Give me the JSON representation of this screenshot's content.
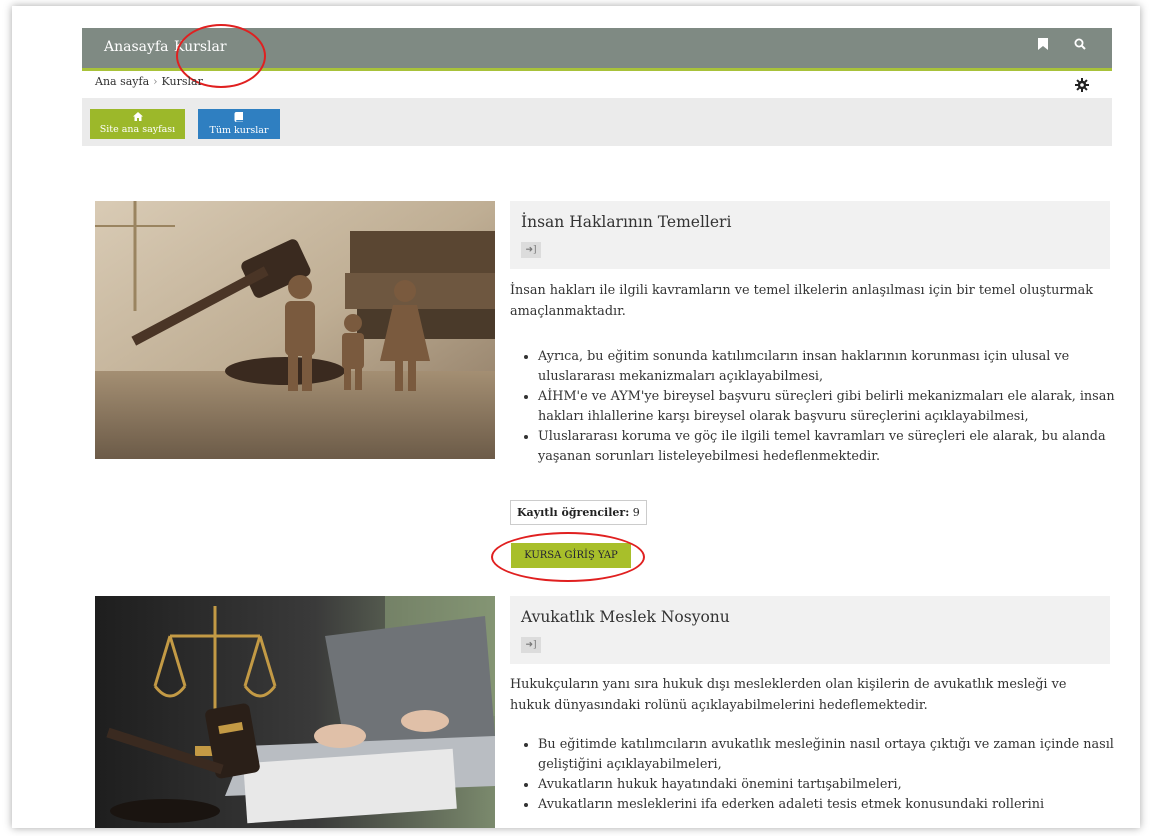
{
  "nav": {
    "home": "Anasayfa",
    "courses": "Kurslar"
  },
  "breadcrumb": {
    "home": "Ana sayfa",
    "separator": "›",
    "current": "Kurslar"
  },
  "toolbar": {
    "site_home": "Site ana sayfası",
    "all_courses": "Tüm kurslar"
  },
  "courses": [
    {
      "title": "İnsan Haklarının Temelleri",
      "summary": "İnsan hakları ile ilgili kavramların ve temel ilkelerin anlaşılması için bir temel oluşturmak amaçlanmaktadır.",
      "bullets": [
        "Ayrıca, bu eğitim sonunda katılımcıların insan haklarının korunması için ulusal ve uluslararası mekanizmaları açıklayabilmesi,",
        "AİHM'e ve AYM'ye bireysel başvuru süreçleri gibi belirli mekanizmaları ele alarak, insan hakları ihlallerine karşı bireysel olarak başvuru süreçlerini açıklayabilmesi,",
        "Uluslararası koruma ve göç ile ilgili temel kavramları ve süreçleri ele alarak, bu alanda yaşanan sorunları listeleyebilmesi hedeflenmektedir."
      ],
      "students_label": "Kayıtlı öğrenciler:",
      "students_count": "9",
      "enter_label": "KURSA GİRİŞ YAP"
    },
    {
      "title": "Avukatlık Meslek Nosyonu",
      "summary": "Hukukçuların yanı sıra hukuk dışı mesleklerden olan kişilerin de avukatlık mesleği ve hukuk dünyasındaki rolünü açıklayabilmelerini hedeflemektedir.",
      "bullets": [
        "Bu eğitimde katılımcıların avukatlık mesleğinin nasıl ortaya çıktığı ve zaman içinde nasıl geliştiğini açıklayabilmeleri,",
        "Avukatların hukuk hayatındaki önemini tartışabilmeleri,",
        "Avukatların mesleklerini ifa ederken adaleti tesis etmek konusundaki rollerini"
      ]
    }
  ],
  "icons": {
    "bookmark": "bookmark-icon",
    "search": "search-icon",
    "settings": "gear-icon",
    "home": "home-icon",
    "book": "book-icon",
    "enter": "sign-in-icon"
  },
  "colors": {
    "navbar": "#7f8a83",
    "accent": "#a8c23a",
    "site_home_button": "#9cb82a",
    "all_courses_button": "#2f7fc1",
    "annotation": "#e02020"
  }
}
